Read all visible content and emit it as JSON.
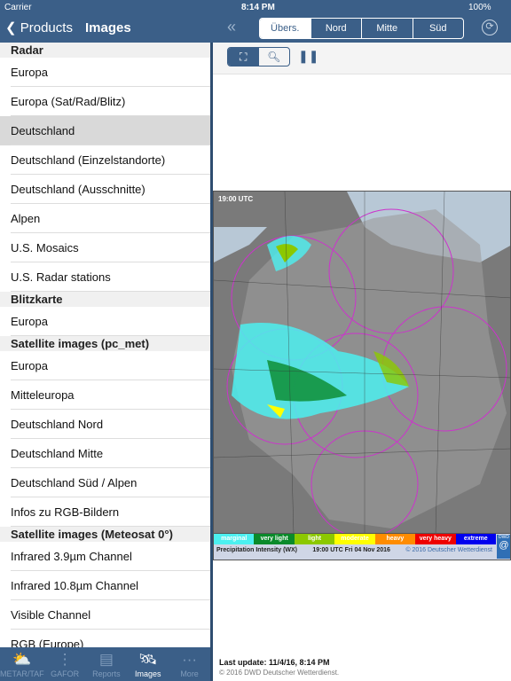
{
  "status": {
    "carrier": "Carrier",
    "time": "8:14 PM",
    "battery": "100%"
  },
  "nav": {
    "back": "Products",
    "title": "Images",
    "segments": [
      "Übers.",
      "Nord",
      "Mitte",
      "Süd"
    ],
    "selected": 0
  },
  "list": [
    {
      "type": "header",
      "label": "Radar"
    },
    {
      "type": "item",
      "label": "Europa"
    },
    {
      "type": "item",
      "label": "Europa (Sat/Rad/Blitz)"
    },
    {
      "type": "item",
      "label": "Deutschland",
      "selected": true
    },
    {
      "type": "item",
      "label": "Deutschland (Einzelstandorte)"
    },
    {
      "type": "item",
      "label": "Deutschland (Ausschnitte)"
    },
    {
      "type": "item",
      "label": "Alpen"
    },
    {
      "type": "item",
      "label": "U.S. Mosaics"
    },
    {
      "type": "item",
      "label": "U.S. Radar stations"
    },
    {
      "type": "header",
      "label": "Blitzkarte"
    },
    {
      "type": "item",
      "label": "Europa"
    },
    {
      "type": "header",
      "label": "Satellite images (pc_met)"
    },
    {
      "type": "item",
      "label": "Europa"
    },
    {
      "type": "item",
      "label": "Mitteleuropa"
    },
    {
      "type": "item",
      "label": "Deutschland Nord"
    },
    {
      "type": "item",
      "label": "Deutschland Mitte"
    },
    {
      "type": "item",
      "label": "Deutschland Süd / Alpen"
    },
    {
      "type": "item",
      "label": "Infos zu RGB-Bildern"
    },
    {
      "type": "header",
      "label": "Satellite images (Meteosat 0°)"
    },
    {
      "type": "item",
      "label": "Infrared 3.9µm Channel"
    },
    {
      "type": "item",
      "label": "Infrared 10.8µm Channel"
    },
    {
      "type": "item",
      "label": "Visible Channel"
    },
    {
      "type": "item",
      "label": "RGB (Europe)"
    }
  ],
  "tabs": [
    {
      "label": "METAR/TAF",
      "icon": "weather-icon"
    },
    {
      "label": "GAFOR",
      "icon": "traffic-light-icon"
    },
    {
      "label": "Reports",
      "icon": "newspaper-icon"
    },
    {
      "label": "Images",
      "icon": "satellite-icon",
      "active": true
    },
    {
      "label": "More",
      "icon": "more-icon"
    }
  ],
  "map": {
    "timestamp": "19:00 UTC",
    "legend": [
      {
        "label": "marginal",
        "color": "#4cf0f0"
      },
      {
        "label": "very light",
        "color": "#0a8a2a"
      },
      {
        "label": "light",
        "color": "#8cc800"
      },
      {
        "label": "moderate",
        "color": "#ffff00"
      },
      {
        "label": "heavy",
        "color": "#ff8c00"
      },
      {
        "label": "very heavy",
        "color": "#ee0000"
      },
      {
        "label": "extreme",
        "color": "#0000ee"
      }
    ],
    "product": "Precipitation Intensity (WX)",
    "datetime": "19:00 UTC Fri 04 Nov 2016",
    "credit": "© 2016 Deutscher Wetterdienst",
    "logo": "DWD"
  },
  "footer": {
    "last_update": "Last update: 11/4/16, 8:14 PM",
    "copyright": "© 2016 DWD Deutscher Wetterdienst."
  }
}
